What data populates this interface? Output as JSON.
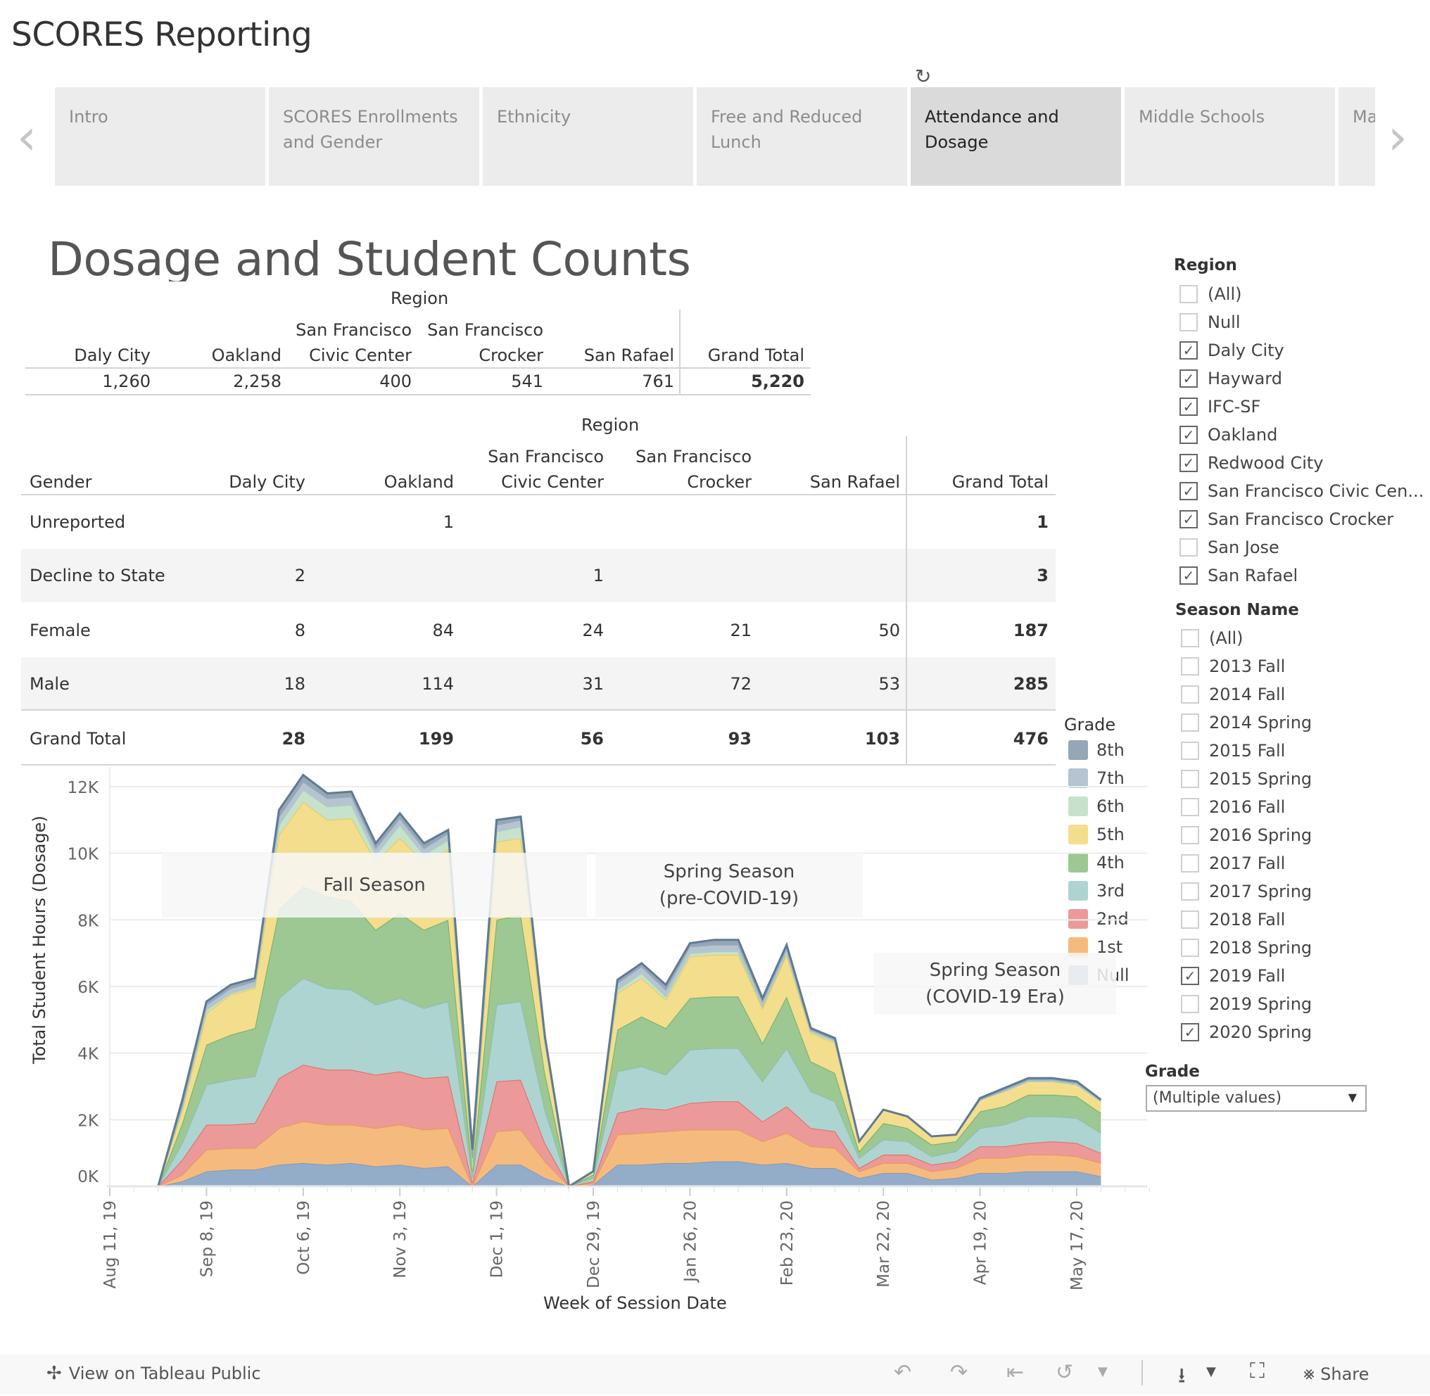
{
  "app": {
    "title": "SCORES Reporting"
  },
  "tabs": [
    {
      "label": "Intro",
      "active": false
    },
    {
      "label": "SCORES Enrollments and Gender",
      "active": false
    },
    {
      "label": "Ethnicity",
      "active": false
    },
    {
      "label": "Free and Reduced Lunch",
      "active": false
    },
    {
      "label": "Attendance and Dosage",
      "active": true
    },
    {
      "label": "Middle Schools",
      "active": false
    },
    {
      "label": "Ma",
      "active": false
    }
  ],
  "icons": {
    "prev": "chevron-left-icon",
    "next": "chevron-right-icon",
    "refresh": "refresh-icon"
  },
  "dashboard": {
    "heading": "Dosage and Student Counts"
  },
  "table1": {
    "group_header": "Region",
    "columns": [
      [
        "",
        "Daly City"
      ],
      [
        "",
        "Oakland"
      ],
      [
        "San Francisco",
        "Civic Center"
      ],
      [
        "San Francisco",
        "Crocker"
      ],
      [
        "",
        "San Rafael"
      ],
      [
        "",
        "Grand Total"
      ]
    ],
    "values": [
      "1,260",
      "2,258",
      "400",
      "541",
      "761",
      "5,220"
    ]
  },
  "table2": {
    "group_header": "Region",
    "row_header": "Gender",
    "columns": [
      [
        "",
        "Daly City"
      ],
      [
        "",
        "Oakland"
      ],
      [
        "San Francisco",
        "Civic Center"
      ],
      [
        "San Francisco",
        "Crocker"
      ],
      [
        "",
        "San Rafael"
      ],
      [
        "",
        "Grand Total"
      ]
    ],
    "rows": [
      {
        "label": "Unreported",
        "values": [
          "",
          "1",
          "",
          "",
          "",
          "1"
        ]
      },
      {
        "label": "Decline to State",
        "values": [
          "2",
          "",
          "1",
          "",
          "",
          "3"
        ]
      },
      {
        "label": "Female",
        "values": [
          "8",
          "84",
          "24",
          "21",
          "50",
          "187"
        ]
      },
      {
        "label": "Male",
        "values": [
          "18",
          "114",
          "31",
          "72",
          "53",
          "285"
        ]
      },
      {
        "label": "Grand Total",
        "values": [
          "28",
          "199",
          "56",
          "93",
          "103",
          "476"
        ]
      }
    ]
  },
  "filters": {
    "region": {
      "title": "Region",
      "options": [
        {
          "label": "(All)",
          "checked": false
        },
        {
          "label": "Null",
          "checked": false
        },
        {
          "label": "Daly City",
          "checked": true
        },
        {
          "label": "Hayward",
          "checked": true
        },
        {
          "label": "IFC-SF",
          "checked": true
        },
        {
          "label": "Oakland",
          "checked": true
        },
        {
          "label": "Redwood City",
          "checked": true
        },
        {
          "label": "San Francisco Civic Cen...",
          "checked": true
        },
        {
          "label": "San Francisco Crocker",
          "checked": true
        },
        {
          "label": "San Jose",
          "checked": false
        },
        {
          "label": "San Rafael",
          "checked": true
        }
      ]
    },
    "season": {
      "title": "Season Name",
      "options": [
        {
          "label": "(All)",
          "checked": false
        },
        {
          "label": "2013 Fall",
          "checked": false
        },
        {
          "label": "2014 Fall",
          "checked": false
        },
        {
          "label": "2014 Spring",
          "checked": false
        },
        {
          "label": "2015 Fall",
          "checked": false
        },
        {
          "label": "2015 Spring",
          "checked": false
        },
        {
          "label": "2016 Fall",
          "checked": false
        },
        {
          "label": "2016 Spring",
          "checked": false
        },
        {
          "label": "2017 Fall",
          "checked": false
        },
        {
          "label": "2017 Spring",
          "checked": false
        },
        {
          "label": "2018 Fall",
          "checked": false
        },
        {
          "label": "2018 Spring",
          "checked": false
        },
        {
          "label": "2019 Fall",
          "checked": true
        },
        {
          "label": "2019 Spring",
          "checked": false
        },
        {
          "label": "2020 Spring",
          "checked": true
        }
      ]
    },
    "grade": {
      "title": "Grade",
      "selected": "(Multiple values)"
    }
  },
  "legend": {
    "title": "Grade",
    "items": [
      {
        "label": "8th",
        "color": "#95a6b5"
      },
      {
        "label": "7th",
        "color": "#b6c4d2"
      },
      {
        "label": "6th",
        "color": "#c6e2cc"
      },
      {
        "label": "5th",
        "color": "#f3de8e"
      },
      {
        "label": "4th",
        "color": "#9dc793"
      },
      {
        "label": "3rd",
        "color": "#aed4d1"
      },
      {
        "label": "2nd",
        "color": "#ec999a"
      },
      {
        "label": "1st",
        "color": "#f5bb7e"
      },
      {
        "label": "Null",
        "color": "#93acc9"
      }
    ]
  },
  "annotations": [
    {
      "text": "Fall Season"
    },
    {
      "text": "Spring Season\n(pre-COVID-19)"
    },
    {
      "text": "Spring Season\n(COVID-19 Era)"
    }
  ],
  "chart_data": {
    "type": "area",
    "stacked": true,
    "title": "",
    "xlabel": "Week of Session Date",
    "ylabel": "Total Student Hours (Dosage)",
    "ylim": [
      0,
      12000
    ],
    "yticks": [
      "0K",
      "2K",
      "4K",
      "6K",
      "8K",
      "10K",
      "12K"
    ],
    "ytick_values": [
      0,
      2000,
      4000,
      6000,
      8000,
      10000,
      12000
    ],
    "x_start": "Aug 11, 19",
    "x_unit": "week",
    "x_week_range": [
      0,
      42
    ],
    "xtick_labels": [
      "Aug 11, 19",
      "Sep 8, 19",
      "Oct 6, 19",
      "Nov 3, 19",
      "Dec 1, 19",
      "Dec 29, 19",
      "Jan 26, 20",
      "Feb 23, 20",
      "Mar 22, 20",
      "Apr 19, 20",
      "May 17, 20"
    ],
    "xtick_weeks": [
      0,
      4,
      8,
      12,
      16,
      20,
      24,
      28,
      32,
      36,
      40
    ],
    "grid": true,
    "legend": "right",
    "weeks": [
      2,
      3,
      4,
      5,
      6,
      7,
      8,
      9,
      10,
      11,
      12,
      13,
      14,
      15,
      16,
      17,
      18,
      19,
      20,
      21,
      22,
      23,
      24,
      25,
      26,
      27,
      28,
      29,
      30,
      31,
      32,
      33,
      34,
      35,
      36,
      37,
      38,
      39,
      40,
      41
    ],
    "series_order_bottom_to_top": [
      "Null",
      "1st",
      "2nd",
      "3rd",
      "4th",
      "5th",
      "6th",
      "7th",
      "8th"
    ],
    "series": [
      {
        "name": "Null",
        "values": [
          0,
          150,
          450,
          500,
          500,
          650,
          700,
          650,
          700,
          600,
          650,
          550,
          600,
          0,
          650,
          650,
          250,
          0,
          50,
          650,
          650,
          700,
          700,
          750,
          750,
          650,
          700,
          550,
          550,
          250,
          400,
          400,
          200,
          250,
          400,
          400,
          450,
          450,
          450,
          300
        ]
      },
      {
        "name": "1st",
        "values": [
          0,
          200,
          650,
          650,
          650,
          1100,
          1250,
          1200,
          1150,
          1150,
          1200,
          1150,
          1150,
          0,
          1000,
          1050,
          500,
          0,
          50,
          900,
          950,
          950,
          1000,
          950,
          950,
          700,
          900,
          650,
          600,
          200,
          300,
          300,
          250,
          300,
          450,
          450,
          500,
          500,
          450,
          400
        ]
      },
      {
        "name": "2nd",
        "values": [
          0,
          450,
          750,
          700,
          750,
          1500,
          1700,
          1650,
          1650,
          1600,
          1600,
          1550,
          1550,
          100,
          1500,
          1500,
          550,
          0,
          50,
          650,
          750,
          650,
          800,
          850,
          850,
          600,
          800,
          550,
          500,
          100,
          250,
          250,
          200,
          200,
          350,
          350,
          350,
          400,
          400,
          300
        ]
      },
      {
        "name": "3rd",
        "values": [
          0,
          500,
          1200,
          1350,
          1400,
          2400,
          2600,
          2450,
          2400,
          2100,
          2200,
          2100,
          2250,
          150,
          2300,
          2350,
          1000,
          0,
          100,
          1250,
          1250,
          1050,
          1600,
          1600,
          1600,
          1200,
          1750,
          1100,
          900,
          300,
          450,
          400,
          250,
          300,
          550,
          650,
          800,
          750,
          750,
          600
        ]
      },
      {
        "name": "4th",
        "values": [
          0,
          600,
          1200,
          1350,
          1450,
          2650,
          2750,
          2750,
          2650,
          2250,
          2550,
          2350,
          2450,
          200,
          2550,
          2600,
          1100,
          0,
          100,
          1250,
          1500,
          1400,
          1550,
          1550,
          1550,
          1150,
          1550,
          900,
          850,
          200,
          500,
          400,
          350,
          300,
          500,
          550,
          650,
          650,
          650,
          600
        ]
      },
      {
        "name": "5th",
        "values": [
          0,
          400,
          950,
          1200,
          1200,
          2250,
          2550,
          2300,
          2500,
          2050,
          2250,
          2050,
          2100,
          150,
          2350,
          2300,
          900,
          0,
          100,
          1100,
          1150,
          850,
          1250,
          1250,
          1250,
          1050,
          1250,
          850,
          900,
          300,
          400,
          350,
          250,
          200,
          350,
          450,
          400,
          400,
          350,
          350
        ]
      },
      {
        "name": "6th",
        "values": [
          0,
          50,
          100,
          50,
          50,
          300,
          350,
          400,
          400,
          200,
          400,
          200,
          300,
          100,
          300,
          350,
          50,
          0,
          0,
          100,
          150,
          100,
          100,
          100,
          100,
          50,
          50,
          50,
          50,
          0,
          0,
          0,
          0,
          0,
          0,
          0,
          0,
          0,
          0,
          0
        ]
      },
      {
        "name": "7th",
        "values": [
          0,
          100,
          150,
          150,
          150,
          250,
          250,
          250,
          250,
          200,
          200,
          200,
          200,
          150,
          200,
          200,
          100,
          0,
          0,
          200,
          200,
          200,
          200,
          200,
          200,
          150,
          150,
          50,
          50,
          0,
          0,
          0,
          0,
          0,
          0,
          50,
          50,
          50,
          50,
          50
        ]
      },
      {
        "name": "8th",
        "values": [
          0,
          150,
          100,
          100,
          100,
          200,
          200,
          150,
          150,
          150,
          150,
          150,
          100,
          250,
          150,
          100,
          50,
          0,
          0,
          100,
          100,
          150,
          100,
          150,
          150,
          100,
          100,
          50,
          50,
          0,
          0,
          0,
          0,
          0,
          50,
          50,
          50,
          50,
          50,
          0
        ]
      }
    ]
  },
  "footer": {
    "view_on_public": "View on Tableau Public",
    "share": "Share"
  }
}
